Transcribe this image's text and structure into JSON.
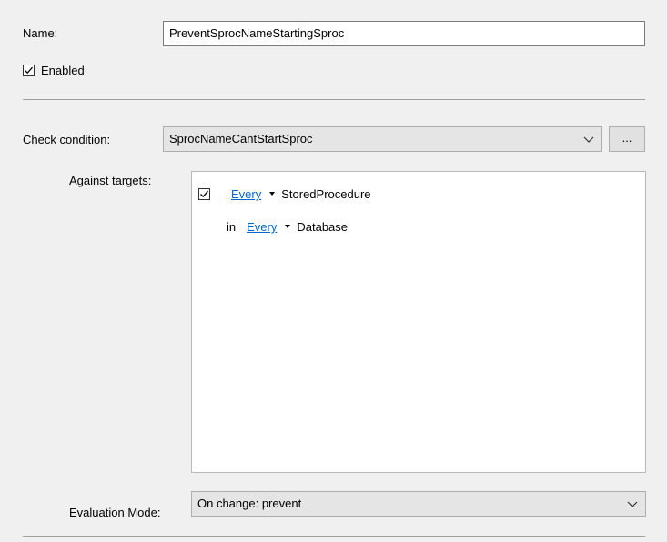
{
  "name": {
    "label": "Name:",
    "value": "PreventSprocNameStartingSproc"
  },
  "enabled": {
    "label": "Enabled",
    "checked": true
  },
  "check_condition": {
    "label": "Check condition:",
    "value": "SprocNameCantStartSproc",
    "browse_label": "..."
  },
  "against_targets": {
    "label": "Against targets:",
    "rows": [
      {
        "checked": true,
        "prefix": "",
        "link": "Every",
        "target": "StoredProcedure"
      },
      {
        "checked": false,
        "prefix": "in",
        "link": "Every",
        "target": "Database"
      }
    ]
  },
  "evaluation_mode": {
    "label": "Evaluation Mode:",
    "value": "On change: prevent"
  }
}
